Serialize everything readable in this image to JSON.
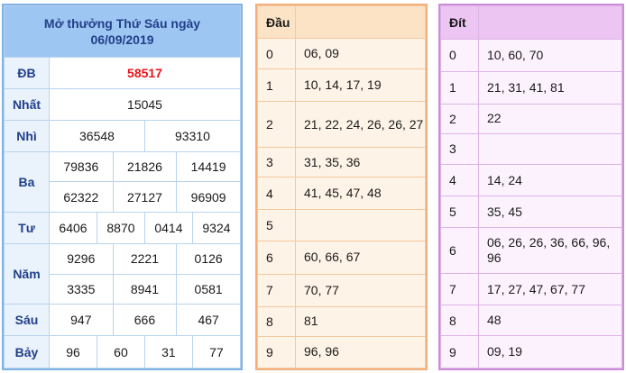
{
  "results": {
    "title_line1": "Mở thưởng Thứ Sáu ngày",
    "title_line2": "06/09/2019",
    "prizes": {
      "db": {
        "label": "ĐB",
        "values": [
          "58517"
        ]
      },
      "nhat": {
        "label": "Nhất",
        "values": [
          "15045"
        ]
      },
      "nhi": {
        "label": "Nhì",
        "values": [
          "36548",
          "93310"
        ]
      },
      "ba": {
        "label": "Ba",
        "values": [
          "79836",
          "21826",
          "14419",
          "62322",
          "27127",
          "96909"
        ]
      },
      "tu": {
        "label": "Tư",
        "values": [
          "6406",
          "8870",
          "0414",
          "9324"
        ]
      },
      "nam": {
        "label": "Năm",
        "values": [
          "9296",
          "2221",
          "0126",
          "3335",
          "8941",
          "0581"
        ]
      },
      "sau": {
        "label": "Sáu",
        "values": [
          "947",
          "666",
          "467"
        ]
      },
      "bay": {
        "label": "Bảy",
        "values": [
          "96",
          "60",
          "31",
          "77"
        ]
      }
    },
    "colors": {
      "header_bg": "#9ec6f2",
      "label_text": "#22408a",
      "special": "#e8141b",
      "border": "#7fb2e5"
    }
  },
  "dau": {
    "header": "Đầu",
    "rows": [
      {
        "key": "0",
        "vals": "06, 09"
      },
      {
        "key": "1",
        "vals": "10, 14, 17, 19"
      },
      {
        "key": "2",
        "vals": "21, 22, 24, 26, 26, 27"
      },
      {
        "key": "3",
        "vals": "31, 35, 36"
      },
      {
        "key": "4",
        "vals": "41, 45, 47, 48"
      },
      {
        "key": "5",
        "vals": ""
      },
      {
        "key": "6",
        "vals": "60, 66, 67"
      },
      {
        "key": "7",
        "vals": "70, 77"
      },
      {
        "key": "8",
        "vals": "81"
      },
      {
        "key": "9",
        "vals": "96, 96"
      }
    ],
    "colors": {
      "header_bg": "#fde3c6",
      "row_bg": "#fef3e7",
      "border": "#f3b07a"
    }
  },
  "dit": {
    "header": "Đít",
    "rows": [
      {
        "key": "0",
        "vals": "10, 60, 70"
      },
      {
        "key": "1",
        "vals": "21, 31, 41, 81"
      },
      {
        "key": "2",
        "vals": "22"
      },
      {
        "key": "3",
        "vals": ""
      },
      {
        "key": "4",
        "vals": "14, 24"
      },
      {
        "key": "5",
        "vals": "35, 45"
      },
      {
        "key": "6",
        "vals": "06, 26, 26, 36, 66, 96, 96"
      },
      {
        "key": "7",
        "vals": "17, 27, 47, 67, 77"
      },
      {
        "key": "8",
        "vals": "48"
      },
      {
        "key": "9",
        "vals": "09, 19"
      }
    ],
    "colors": {
      "header_bg": "#ecc5f2",
      "row_bg": "#fcf2fd",
      "border": "#cc8ed9"
    }
  }
}
